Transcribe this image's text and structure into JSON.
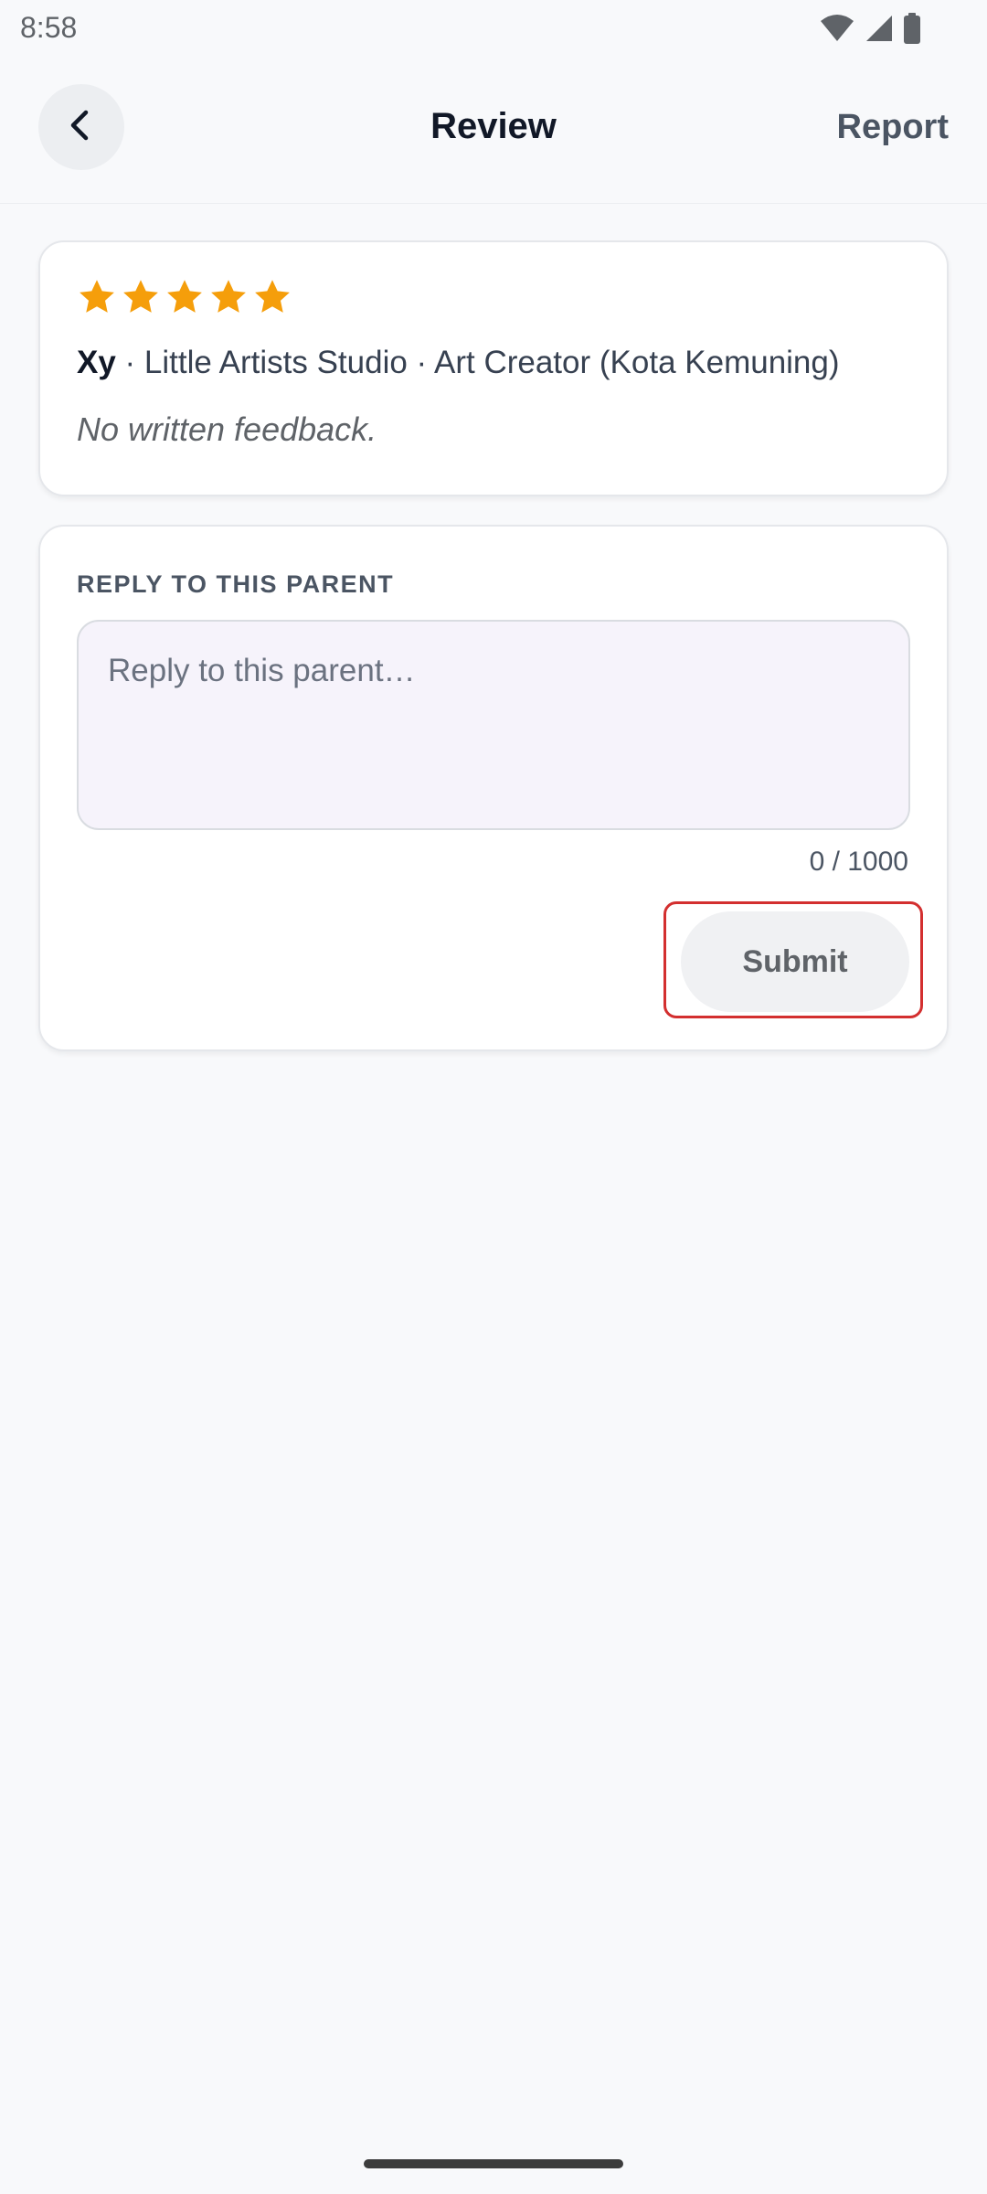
{
  "status_bar": {
    "time": "8:58",
    "icons": [
      "wifi-icon",
      "signal-icon",
      "battery-icon"
    ]
  },
  "header": {
    "back_icon": "chevron-left-icon",
    "title": "Review",
    "report_label": "Report"
  },
  "review": {
    "rating": 5,
    "max_rating": 5,
    "star_color": "#f59e0b",
    "reviewer_name": "Xy",
    "details": " · Little Artists Studio · Art Creator (Kota Kemuning)",
    "feedback": "No written feedback."
  },
  "reply": {
    "label": "REPLY TO THIS PARENT",
    "value": "",
    "placeholder": "Reply to this parent…",
    "char_count": "0 / 1000",
    "submit_label": "Submit"
  },
  "colors": {
    "background": "#f8f9fb",
    "card": "#ffffff",
    "input_background": "#f6f3fb",
    "highlight_border": "#d32f2f"
  }
}
